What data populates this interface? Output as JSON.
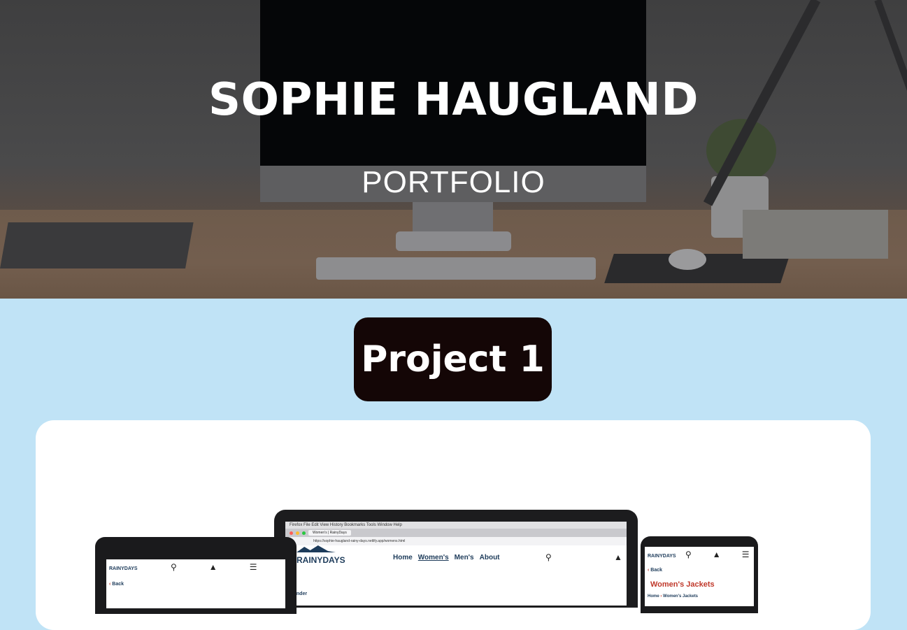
{
  "hero": {
    "title": "SOPHIE HAUGLAND",
    "subtitle": "PORTFOLIO"
  },
  "project": {
    "heading": "Project 1"
  },
  "mockup": {
    "laptop": {
      "menu_bar": "Firefox   File   Edit   View   History   Bookmarks   Tools   Window   Help",
      "tab_title": "Women's | RainyDays",
      "url": "https://sophie-haugland-rainy-days.netlify.app/womens.html",
      "logo": "RAINYDAYS",
      "nav": [
        "Home",
        "Women's",
        "Men's",
        "About"
      ],
      "active_nav": "Women's",
      "side_label": "ender"
    },
    "tablet": {
      "logo": "RAINYDAYS",
      "back": "Back"
    },
    "phone": {
      "logo": "RAINYDAYS",
      "back": "Back",
      "heading": "Women's Jackets",
      "breadcrumb": [
        "Home",
        "Women's Jackets"
      ]
    },
    "colors": {
      "brand_navy": "#1d3b5a",
      "accent_red": "#c0392b",
      "section_bg": "#c0e3f6",
      "badge_bg": "#140606"
    },
    "icons": [
      "search-icon",
      "basket-icon",
      "menu-icon",
      "back-chevron-icon"
    ]
  }
}
